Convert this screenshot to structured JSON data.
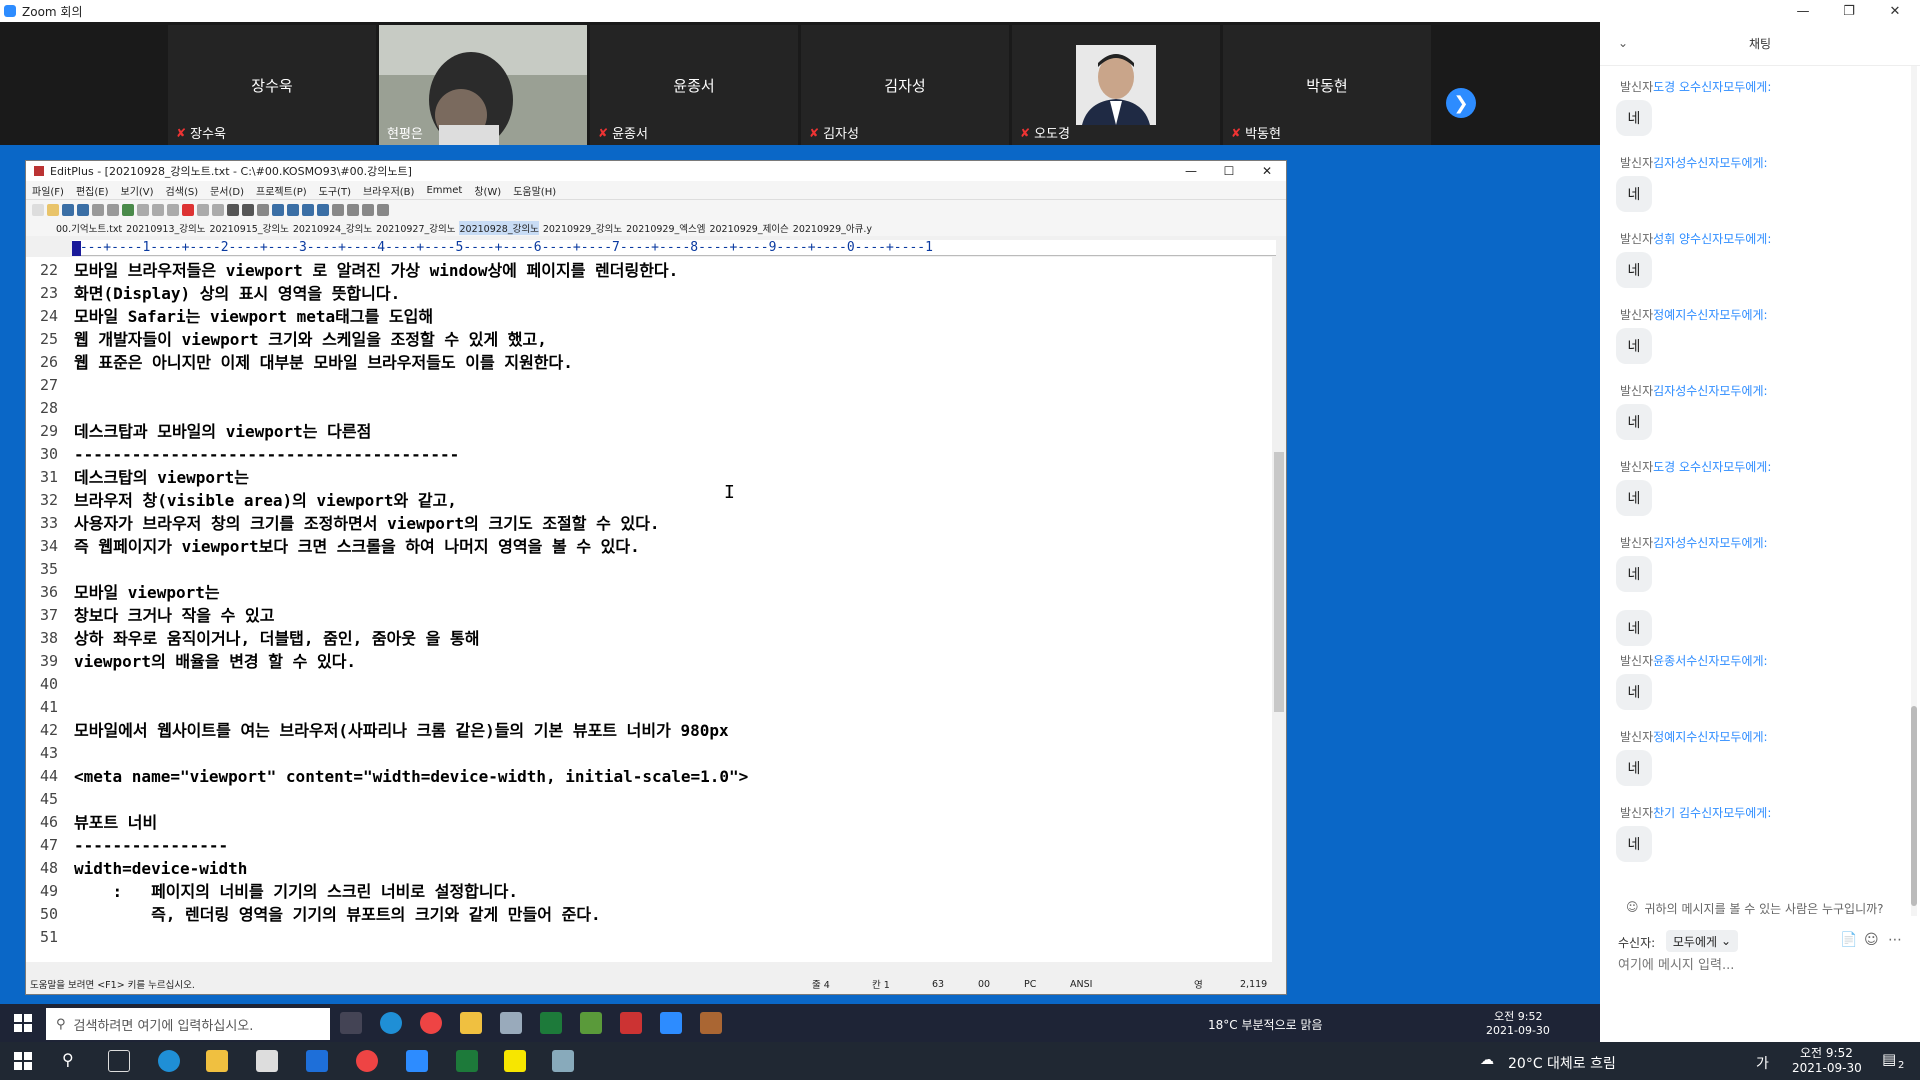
{
  "zoom": {
    "title": "Zoom 회의",
    "participants": [
      {
        "name": "장수욱",
        "label": "장수욱",
        "muted": true
      },
      {
        "name": "",
        "label": "현평은",
        "muted": false,
        "video": true
      },
      {
        "name": "윤종서",
        "label": "윤종서",
        "muted": true
      },
      {
        "name": "김자성",
        "label": "김자성",
        "muted": true
      },
      {
        "name": "",
        "label": "오도경",
        "muted": true,
        "photo": true
      },
      {
        "name": "박동현",
        "label": "박동현",
        "muted": true
      }
    ]
  },
  "editplus": {
    "title": "EditPlus - [20210928_강의노트.txt - C:\\#00.KOSMO93\\#00.강의노트]",
    "menu": [
      "파일(F)",
      "편집(E)",
      "보기(V)",
      "검색(S)",
      "문서(D)",
      "프로젝트(P)",
      "도구(T)",
      "브라우저(B)",
      "Emmet",
      "창(W)",
      "도움말(H)"
    ],
    "tabs": [
      "00.기억노트.txt",
      "20210913_강의노",
      "20210915_강의노",
      "20210924_강의노",
      "20210927_강의노",
      "20210928_강의노",
      "20210929_강의노",
      "20210929_엑스엠",
      "20210929_제이슨",
      "20210929_아큐.y"
    ],
    "active_tab": 5,
    "ruler": "----+----1----+----2----+----3----+----4----+----5----+----6----+----7----+----8----+----9----+----0----+----1",
    "lines": [
      {
        "n": "22",
        "t": "모바일 브라우저들은 viewport 로 알려진 가상 window상에 페이지를 렌더링한다."
      },
      {
        "n": "23",
        "t": "화면(Display) 상의 표시 영역을 뜻합니다."
      },
      {
        "n": "24",
        "t": "모바일 Safari는 viewport meta태그를 도입해"
      },
      {
        "n": "25",
        "t": "웹 개발자들이 viewport 크기와 스케일을 조정할 수 있게 했고,"
      },
      {
        "n": "26",
        "t": "웹 표준은 아니지만 이제 대부분 모바일 브라우저들도 이를 지원한다."
      },
      {
        "n": "27",
        "t": ""
      },
      {
        "n": "28",
        "t": ""
      },
      {
        "n": "29",
        "t": "데스크탑과 모바일의 viewport는 다른점"
      },
      {
        "n": "30",
        "t": "----------------------------------------"
      },
      {
        "n": "31",
        "t": "데스크탑의 viewport는"
      },
      {
        "n": "32",
        "t": "브라우저 창(visible area)의 viewport와 같고,"
      },
      {
        "n": "33",
        "t": "사용자가 브라우저 창의 크기를 조정하면서 viewport의 크기도 조절할 수 있다."
      },
      {
        "n": "34",
        "t": "즉 웹페이지가 viewport보다 크면 스크롤을 하여 나머지 영역을 볼 수 있다."
      },
      {
        "n": "35",
        "t": ""
      },
      {
        "n": "36",
        "t": "모바일 viewport는"
      },
      {
        "n": "37",
        "t": "창보다 크거나 작을 수 있고"
      },
      {
        "n": "38",
        "t": "상하 좌우로 움직이거나, 더블탭, 줌인, 줌아웃 을 통해"
      },
      {
        "n": "39",
        "t": "viewport의 배율을 변경 할 수 있다."
      },
      {
        "n": "40",
        "t": ""
      },
      {
        "n": "41",
        "t": ""
      },
      {
        "n": "42",
        "t": "모바일에서 웹사이트를 여는 브라우저(사파리나 크롬 같은)들의 기본 뷰포트 너비가 980px"
      },
      {
        "n": "43",
        "t": ""
      },
      {
        "n": "44",
        "t": "<meta name=\"viewport\" content=\"width=device-width, initial-scale=1.0\">"
      },
      {
        "n": "45",
        "t": ""
      },
      {
        "n": "46",
        "t": "뷰포트 너비"
      },
      {
        "n": "47",
        "t": "----------------"
      },
      {
        "n": "48",
        "t": "width=device-width"
      },
      {
        "n": "49",
        "t": "    :   페이지의 너비를 기기의 스크린 너비로 설정합니다."
      },
      {
        "n": "50",
        "t": "        즉, 렌더링 영역을 기기의 뷰포트의 크기와 같게 만들어 준다."
      },
      {
        "n": "51",
        "t": ""
      }
    ],
    "status": {
      "help": "도움말을 보려면 <F1> 키를 누르십시오.",
      "line": "줄 4",
      "col": "칸 1",
      "n1": "63",
      "n2": "00",
      "mode": "PC",
      "enc": "ANSI",
      "ins": "영",
      "size": "2,119"
    }
  },
  "chat": {
    "title": "채팅",
    "messages": [
      {
        "prefix": "발신자",
        "from": "도경 오수신자",
        "to": "모두에게:",
        "text": "네"
      },
      {
        "prefix": "발신자",
        "from": "김자성수신자",
        "to": "모두에게:",
        "text": "네"
      },
      {
        "prefix": "발신자",
        "from": "성휘 양수신자",
        "to": "모두에게:",
        "text": "네"
      },
      {
        "prefix": "발신자",
        "from": "정예지수신자",
        "to": "모두에게:",
        "text": "네"
      },
      {
        "prefix": "발신자",
        "from": "김자성수신자",
        "to": "모두에게:",
        "text": "네"
      },
      {
        "prefix": "발신자",
        "from": "도경 오수신자",
        "to": "모두에게:",
        "text": "네"
      },
      {
        "prefix": "발신자",
        "from": "김자성수신자",
        "to": "모두에게:",
        "text": "네"
      },
      {
        "prefix": "",
        "from": "",
        "to": "",
        "text": "네"
      },
      {
        "prefix": "발신자",
        "from": "윤종서수신자",
        "to": "모두에게:",
        "text": "네"
      },
      {
        "prefix": "발신자",
        "from": "정예지수신자",
        "to": "모두에게:",
        "text": "네"
      },
      {
        "prefix": "발신자",
        "from": "찬기 김수신자",
        "to": "모두에게:",
        "text": "네"
      }
    ],
    "who_can_see": "귀하의 메시지를 볼 수 있는 사람은 누구입니까?",
    "recipient_label": "수신자:",
    "recipient_value": "모두에게",
    "input_placeholder": "여기에 메시지 입력..."
  },
  "inner_taskbar": {
    "search_placeholder": "검색하려면 여기에 입력하십시오.",
    "weather": "18°C  부분적으로 맑음",
    "time": "오전 9:52",
    "date": "2021-09-30"
  },
  "taskbar": {
    "weather": "20°C  대체로 흐림",
    "ime": "가",
    "time": "오전 9:52",
    "date": "2021-09-30",
    "notif": "2"
  }
}
